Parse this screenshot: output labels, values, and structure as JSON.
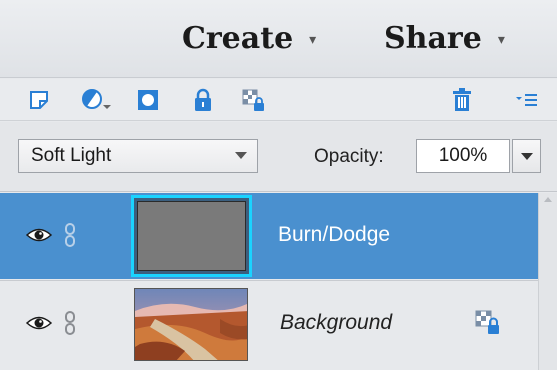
{
  "header": {
    "create_label": "Create",
    "share_label": "Share",
    "caret": "▾"
  },
  "toolbar": {
    "icons": [
      "new-layer-icon",
      "adjustment-layer-icon",
      "layer-mask-icon",
      "lock-all-icon",
      "lock-transparency-icon",
      "trash-icon",
      "panel-menu-icon"
    ]
  },
  "blend": {
    "mode": "Soft Light",
    "opacity_label": "Opacity:",
    "opacity_value": "100%"
  },
  "layers": [
    {
      "name": "Burn/Dodge",
      "selected": true,
      "thumb_color": "#7a7a7a"
    },
    {
      "name": "Background",
      "selected": false
    }
  ],
  "colors": {
    "selection": "#4a90cf",
    "thumb_highlight": "#1ad3ff",
    "accent_blue": "#2a7fd4"
  }
}
